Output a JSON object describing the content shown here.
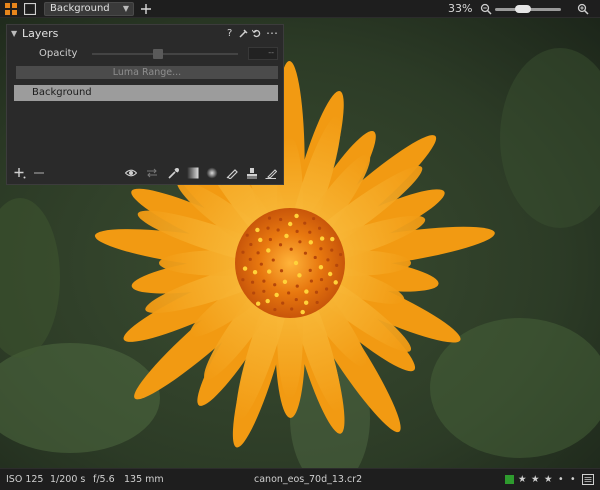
{
  "toolbar": {
    "layer_select_value": "Background",
    "zoom_label": "33%",
    "zoom_level_fraction": 0.35
  },
  "layers_panel": {
    "title": "Layers",
    "opacity_label": "Opacity",
    "opacity_value": "--",
    "luma_range_label": "Luma Range...",
    "layers": [
      {
        "name": "Background"
      }
    ],
    "header_icons": [
      "help-icon",
      "brush-icon",
      "reset-icon",
      "more-icon"
    ],
    "bottom_icons": [
      "add-layer-icon",
      "remove-layer-icon",
      "eye-icon",
      "swap-icon",
      "picker-icon",
      "gradient-mask-icon",
      "radial-mask-icon",
      "draw-mask-icon",
      "stamp-icon",
      "erase-mask-icon"
    ]
  },
  "status_bar": {
    "iso": "ISO 125",
    "shutter": "1/200 s",
    "aperture": "f/5.6",
    "focal": "135 mm",
    "filename": "canon_eos_70d_13.cr2",
    "color_tag": "#2e9b2e",
    "rating": 3,
    "rating_max": 5
  },
  "colors": {
    "petal": "#f6a81c",
    "petal_light": "#fbc23e",
    "center": "#e2730e",
    "background": "#2b3b27"
  }
}
